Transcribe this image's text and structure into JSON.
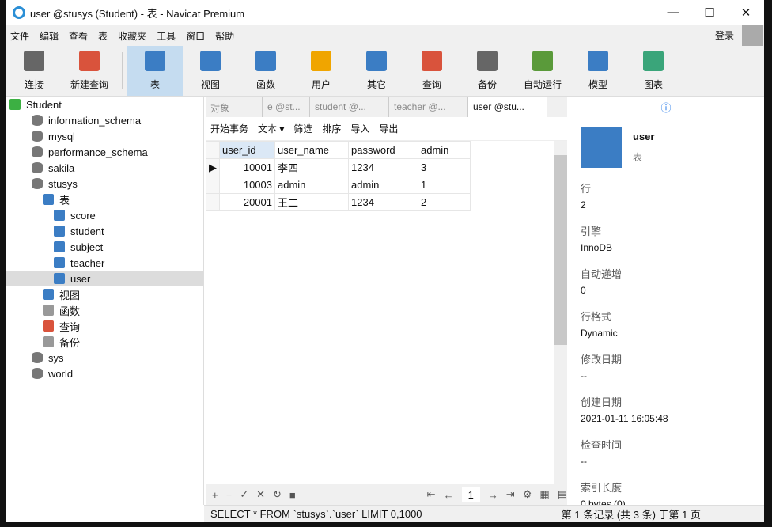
{
  "window": {
    "title": "user @stusys (Student) - 表 - Navicat Premium",
    "controls": [
      "—",
      "☐",
      "✕"
    ]
  },
  "menu": [
    "文件",
    "编辑",
    "查看",
    "表",
    "收藏夹",
    "工具",
    "窗口",
    "帮助"
  ],
  "login": "登录",
  "toolbar": [
    {
      "label": "连接",
      "color": "#666"
    },
    {
      "label": "新建查询",
      "color": "#d9533c"
    },
    {
      "label": "表",
      "color": "#3b7dc4",
      "selected": true
    },
    {
      "label": "视图",
      "color": "#3b7dc4"
    },
    {
      "label": "函数",
      "color": "#3b7dc4"
    },
    {
      "label": "用户",
      "color": "#f0a500"
    },
    {
      "label": "其它",
      "color": "#3b7dc4"
    },
    {
      "label": "查询",
      "color": "#d9533c"
    },
    {
      "label": "备份",
      "color": "#666"
    },
    {
      "label": "自动运行",
      "color": "#5a9a3a"
    },
    {
      "label": "模型",
      "color": "#3b7dc4"
    },
    {
      "label": "图表",
      "color": "#3aa57a"
    }
  ],
  "tree": [
    {
      "label": "Student",
      "level": 0,
      "type": "conn"
    },
    {
      "label": "information_schema",
      "level": 1,
      "type": "db"
    },
    {
      "label": "mysql",
      "level": 1,
      "type": "db"
    },
    {
      "label": "performance_schema",
      "level": 1,
      "type": "db"
    },
    {
      "label": "sakila",
      "level": 1,
      "type": "db"
    },
    {
      "label": "stusys",
      "level": 1,
      "type": "db"
    },
    {
      "label": "表",
      "level": 2,
      "type": "tbl"
    },
    {
      "label": "score",
      "level": 3,
      "type": "tbl"
    },
    {
      "label": "student",
      "level": 3,
      "type": "tbl"
    },
    {
      "label": "subject",
      "level": 3,
      "type": "tbl"
    },
    {
      "label": "teacher",
      "level": 3,
      "type": "tbl"
    },
    {
      "label": "user",
      "level": 3,
      "type": "tbl",
      "selected": true
    },
    {
      "label": "视图",
      "level": 2,
      "type": "tbl"
    },
    {
      "label": "函数",
      "level": 2,
      "type": "fx"
    },
    {
      "label": "查询",
      "level": 2,
      "type": "q"
    },
    {
      "label": "备份",
      "level": 2,
      "type": "b"
    },
    {
      "label": "sys",
      "level": 1,
      "type": "db"
    },
    {
      "label": "world",
      "level": 1,
      "type": "db"
    }
  ],
  "tabs": [
    {
      "label": "对象"
    },
    {
      "label": "e @st..."
    },
    {
      "label": "student @..."
    },
    {
      "label": "teacher @..."
    },
    {
      "label": "user @stu...",
      "active": true
    }
  ],
  "subtoolbar": [
    "开始事务",
    "文本 ▾",
    "筛选",
    "排序",
    "导入",
    "导出"
  ],
  "grid": {
    "columns": [
      "user_id",
      "user_name",
      "password",
      "admin"
    ],
    "rows": [
      [
        "10001",
        "李四",
        "1234",
        "3"
      ],
      [
        "10003",
        "admin",
        "admin",
        "1"
      ],
      [
        "20001",
        "王二",
        "1234",
        "2"
      ]
    ]
  },
  "bottom": {
    "buttons": [
      "+",
      "−",
      "✓",
      "✕",
      "↻",
      "■"
    ],
    "nav": [
      "⇤",
      "←",
      "→",
      "⇥",
      "⚙"
    ],
    "page": "1"
  },
  "info": {
    "name": "user",
    "type": "表",
    "fields": [
      {
        "label": "行",
        "value": "2"
      },
      {
        "label": "引擎",
        "value": "InnoDB"
      },
      {
        "label": "自动递增",
        "value": "0"
      },
      {
        "label": "行格式",
        "value": "Dynamic"
      },
      {
        "label": "修改日期",
        "value": "--"
      },
      {
        "label": "创建日期",
        "value": "2021-01-11 16:05:48"
      },
      {
        "label": "检查时间",
        "value": "--"
      },
      {
        "label": "索引长度",
        "value": "0 bytes (0)"
      }
    ]
  },
  "status": {
    "sql": "SELECT * FROM `stusys`.`user` LIMIT 0,1000",
    "records": "第 1 条记录 (共 3 条) 于第 1 页"
  }
}
